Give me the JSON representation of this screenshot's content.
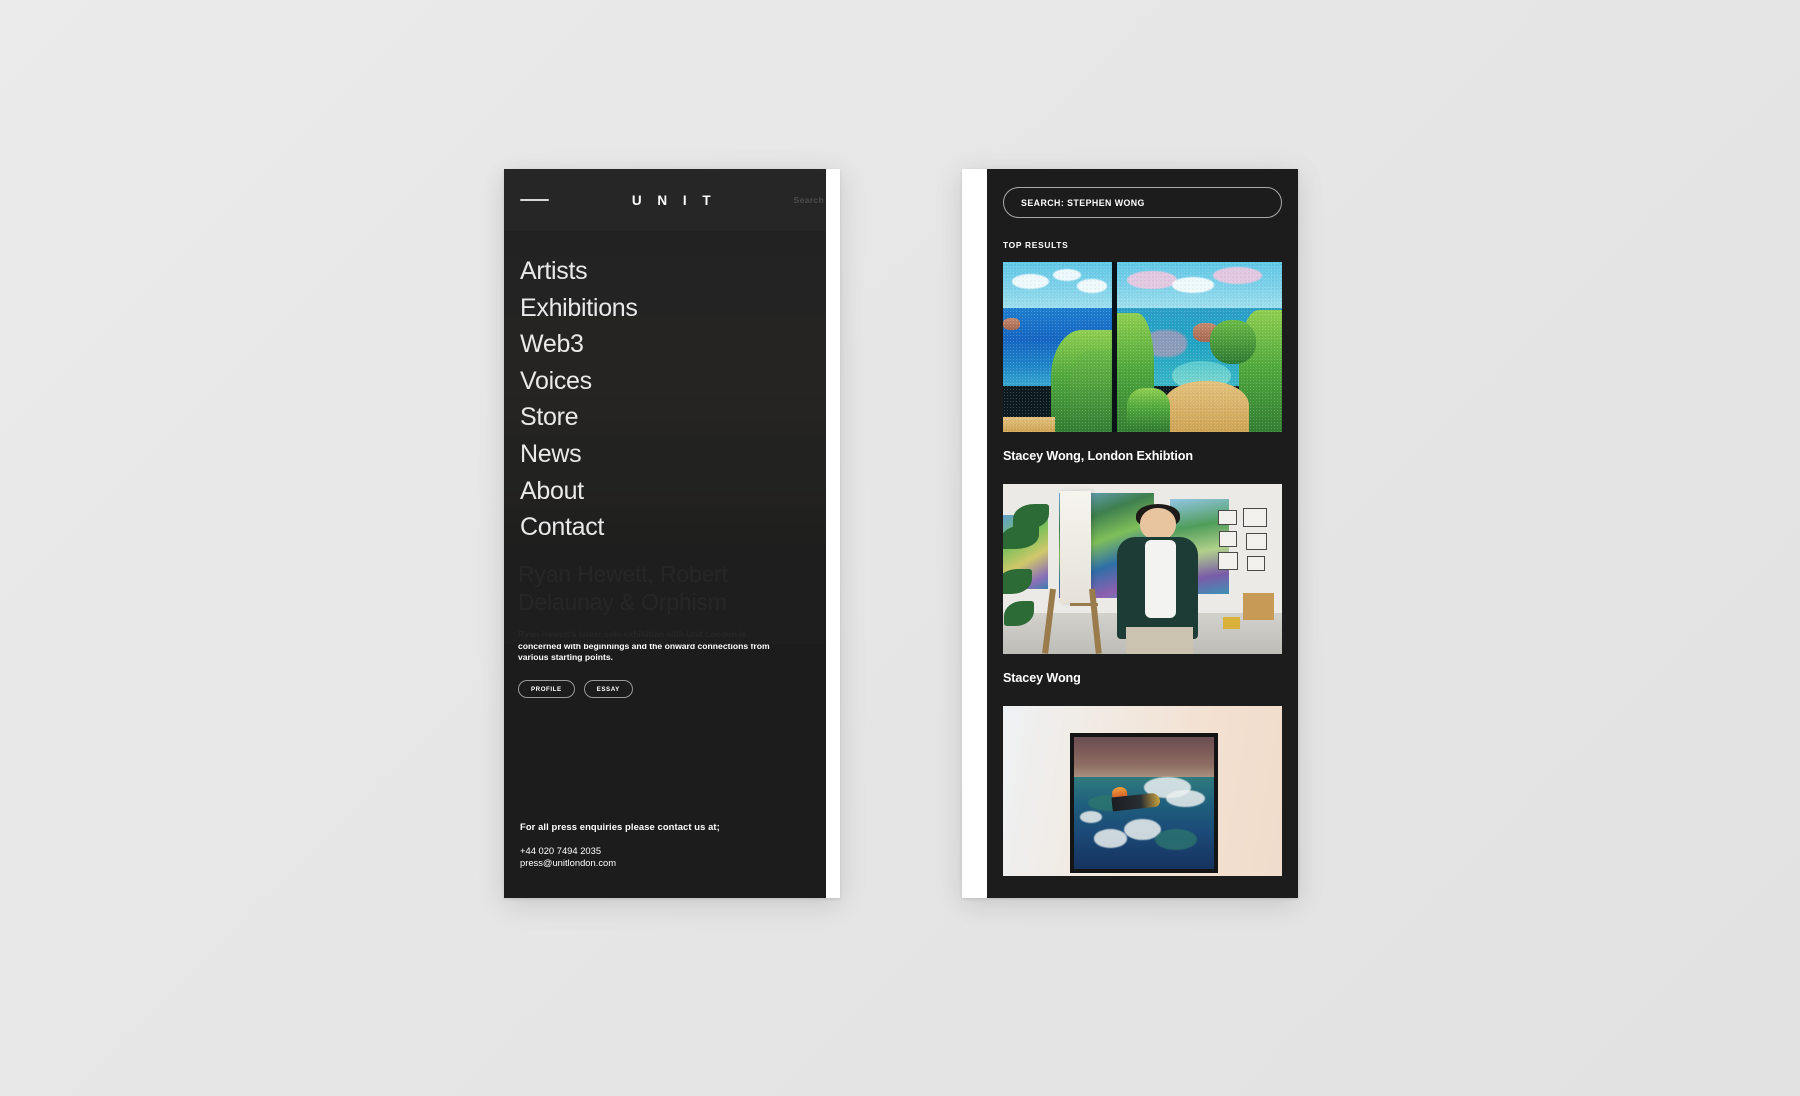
{
  "backdrop": {
    "color": "#e8e8e8"
  },
  "left_phone": {
    "topbar": {
      "menu_icon": "menu-line-icon",
      "brand": "U N I T",
      "search_label": "Search"
    },
    "nav": {
      "items": [
        {
          "label": "Artists"
        },
        {
          "label": "Exhibitions"
        },
        {
          "label": "Web3"
        },
        {
          "label": "Voices"
        },
        {
          "label": "Store"
        },
        {
          "label": "News"
        },
        {
          "label": "About"
        },
        {
          "label": "Contact"
        }
      ]
    },
    "press": {
      "heading": "For all press enquiries please contact us at;",
      "phone": "+44 020 7494 2035",
      "email": "press@unitlondon.com"
    },
    "underlying_page": {
      "title": "Ryan Hewett, Robert Delaunay & Orphism",
      "paragraph": "Ryan Hewett's latest solo exhibition with Unit London is concerned with beginnings and the onward connections from various starting points.",
      "chips": [
        "PROFILE",
        "ESSAY"
      ]
    }
  },
  "right_phone": {
    "search": {
      "value": "SEARCH: STEPHEN WONG",
      "placeholder": "SEARCH"
    },
    "results_heading": "TOP RESULTS",
    "results": [
      {
        "caption": "Stacey Wong, London Exhibtion",
        "thumb": "coastal-diptych-artwork"
      },
      {
        "caption": "Stacey Wong",
        "thumb": "artist-in-studio-photo"
      },
      {
        "caption": "",
        "thumb": "framed-seascape-on-wall"
      }
    ]
  },
  "colors": {
    "panel_dark": "#1c1c1c",
    "topbar_dark": "#262626",
    "nav_overlay": "#1e1e1e",
    "text_light": "#ffffff"
  }
}
